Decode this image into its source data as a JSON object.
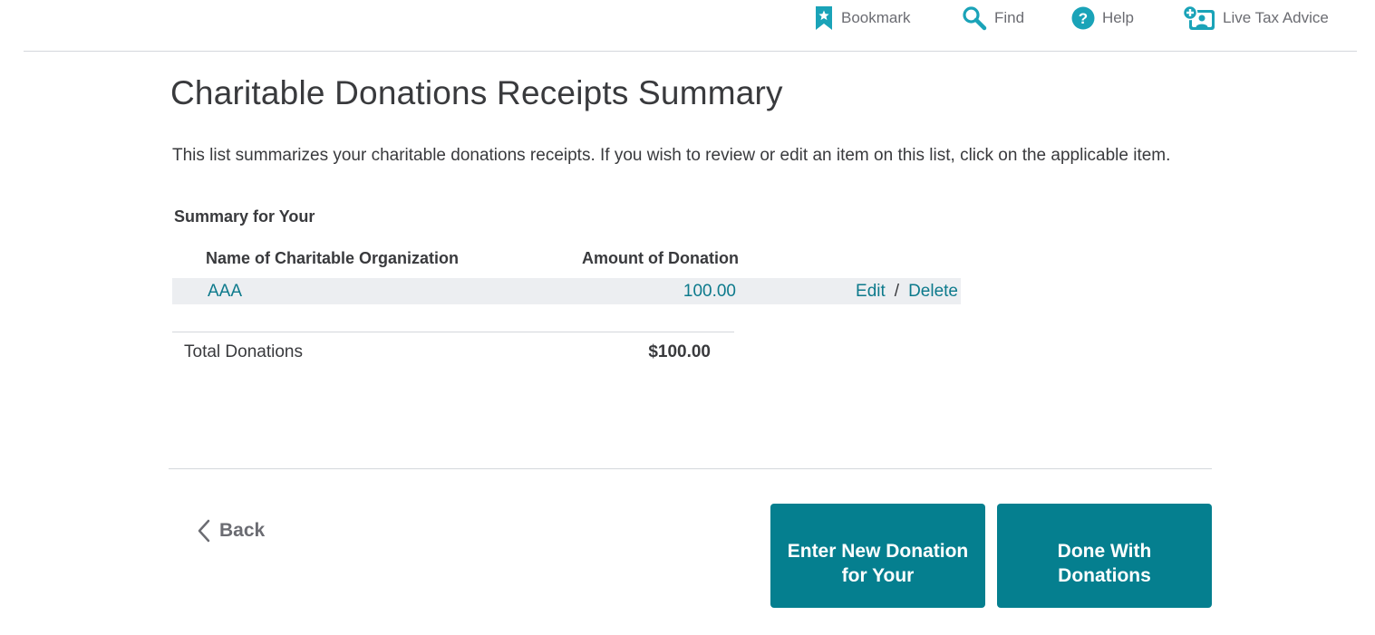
{
  "toolbar": {
    "bookmark": {
      "label": "Bookmark",
      "icon": "bookmark-icon"
    },
    "find": {
      "label": "Find",
      "icon": "search-icon"
    },
    "help": {
      "label": "Help",
      "icon": "help-icon"
    },
    "live_advice": {
      "label": "Live Tax Advice",
      "icon": "live-advice-icon"
    }
  },
  "page": {
    "title": "Charitable Donations Receipts Summary",
    "intro": "This list summarizes your charitable donations receipts. If you wish to review or edit an item on this list, click on the applicable item.",
    "summary_heading": "Summary for Your"
  },
  "table": {
    "columns": {
      "name": "Name of Charitable Organization",
      "amount": "Amount of Donation"
    },
    "rows": [
      {
        "name": "AAA",
        "amount": "100.00",
        "edit": "Edit",
        "separator": "/",
        "delete": "Delete"
      }
    ],
    "total_label": "Total Donations",
    "total_value": "$100.00"
  },
  "footer": {
    "back_label": "Back",
    "enter_new_label": "Enter New Donation for Your",
    "done_label": "Done With Donations"
  },
  "colors": {
    "accent": "#057f8f",
    "link": "#0d7a8c",
    "icon": "#1aa3b8",
    "text": "#393a3d",
    "muted": "#6b6c72",
    "row_bg": "#eceef1"
  }
}
